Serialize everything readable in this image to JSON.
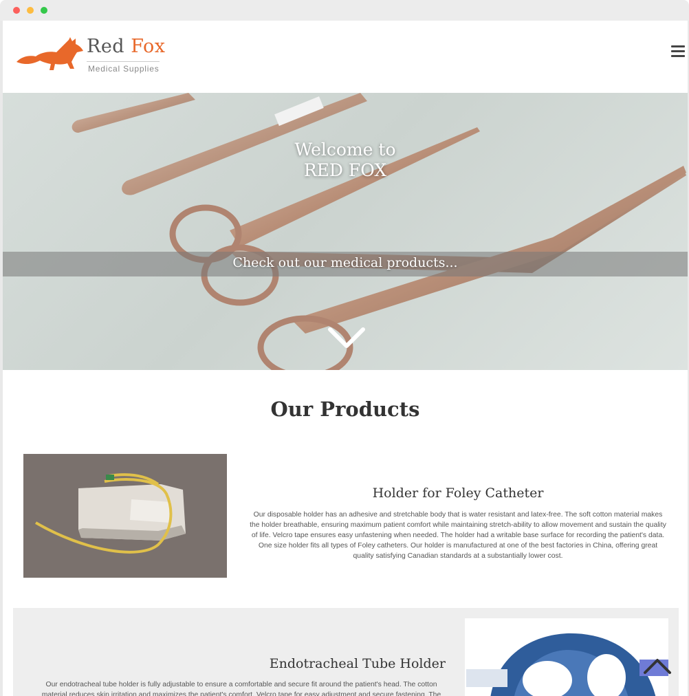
{
  "window": {
    "controls": [
      "close",
      "minimize",
      "maximize"
    ]
  },
  "brand": {
    "name_first": "Red",
    "name_second": "Fox",
    "tagline": "Medical Supplies",
    "accent_color": "#e8682a",
    "logo_icon": "fox-icon"
  },
  "nav": {
    "menu_icon": "hamburger-menu-icon"
  },
  "hero": {
    "title_line1": "Welcome to",
    "title_line2": "RED FOX",
    "band_text": "Check out our medical products...",
    "scroll_icon": "chevron-down-icon"
  },
  "products_section": {
    "heading": "Our Products",
    "items": [
      {
        "title": "Holder for Foley Catheter",
        "description": "Our disposable holder has an adhesive and stretchable body that is water resistant and latex-free. The soft cotton material makes the holder breathable, ensuring maximum patient comfort while maintaining stretch-ability to allow movement and sustain the quality of life. Velcro tape ensures easy unfastening when needed. The holder had a writable base surface for recording the patient's data. One size holder fits all types of Foley catheters. Our holder is manufactured at one of the best factories in China, offering great quality satisfying Canadian standards at a substantially lower cost."
      },
      {
        "title": "Endotracheal Tube Holder",
        "description": "Our endotracheal tube holder is fully adjustable to ensure a comfortable and secure fit around the patient's head. The cotton material reduces skin irritation and maximizes the patient's comfort. Velcro tape for easy adjustment and secure fastening. The"
      }
    ]
  },
  "back_to_top": {
    "icon": "chevron-up-icon"
  }
}
